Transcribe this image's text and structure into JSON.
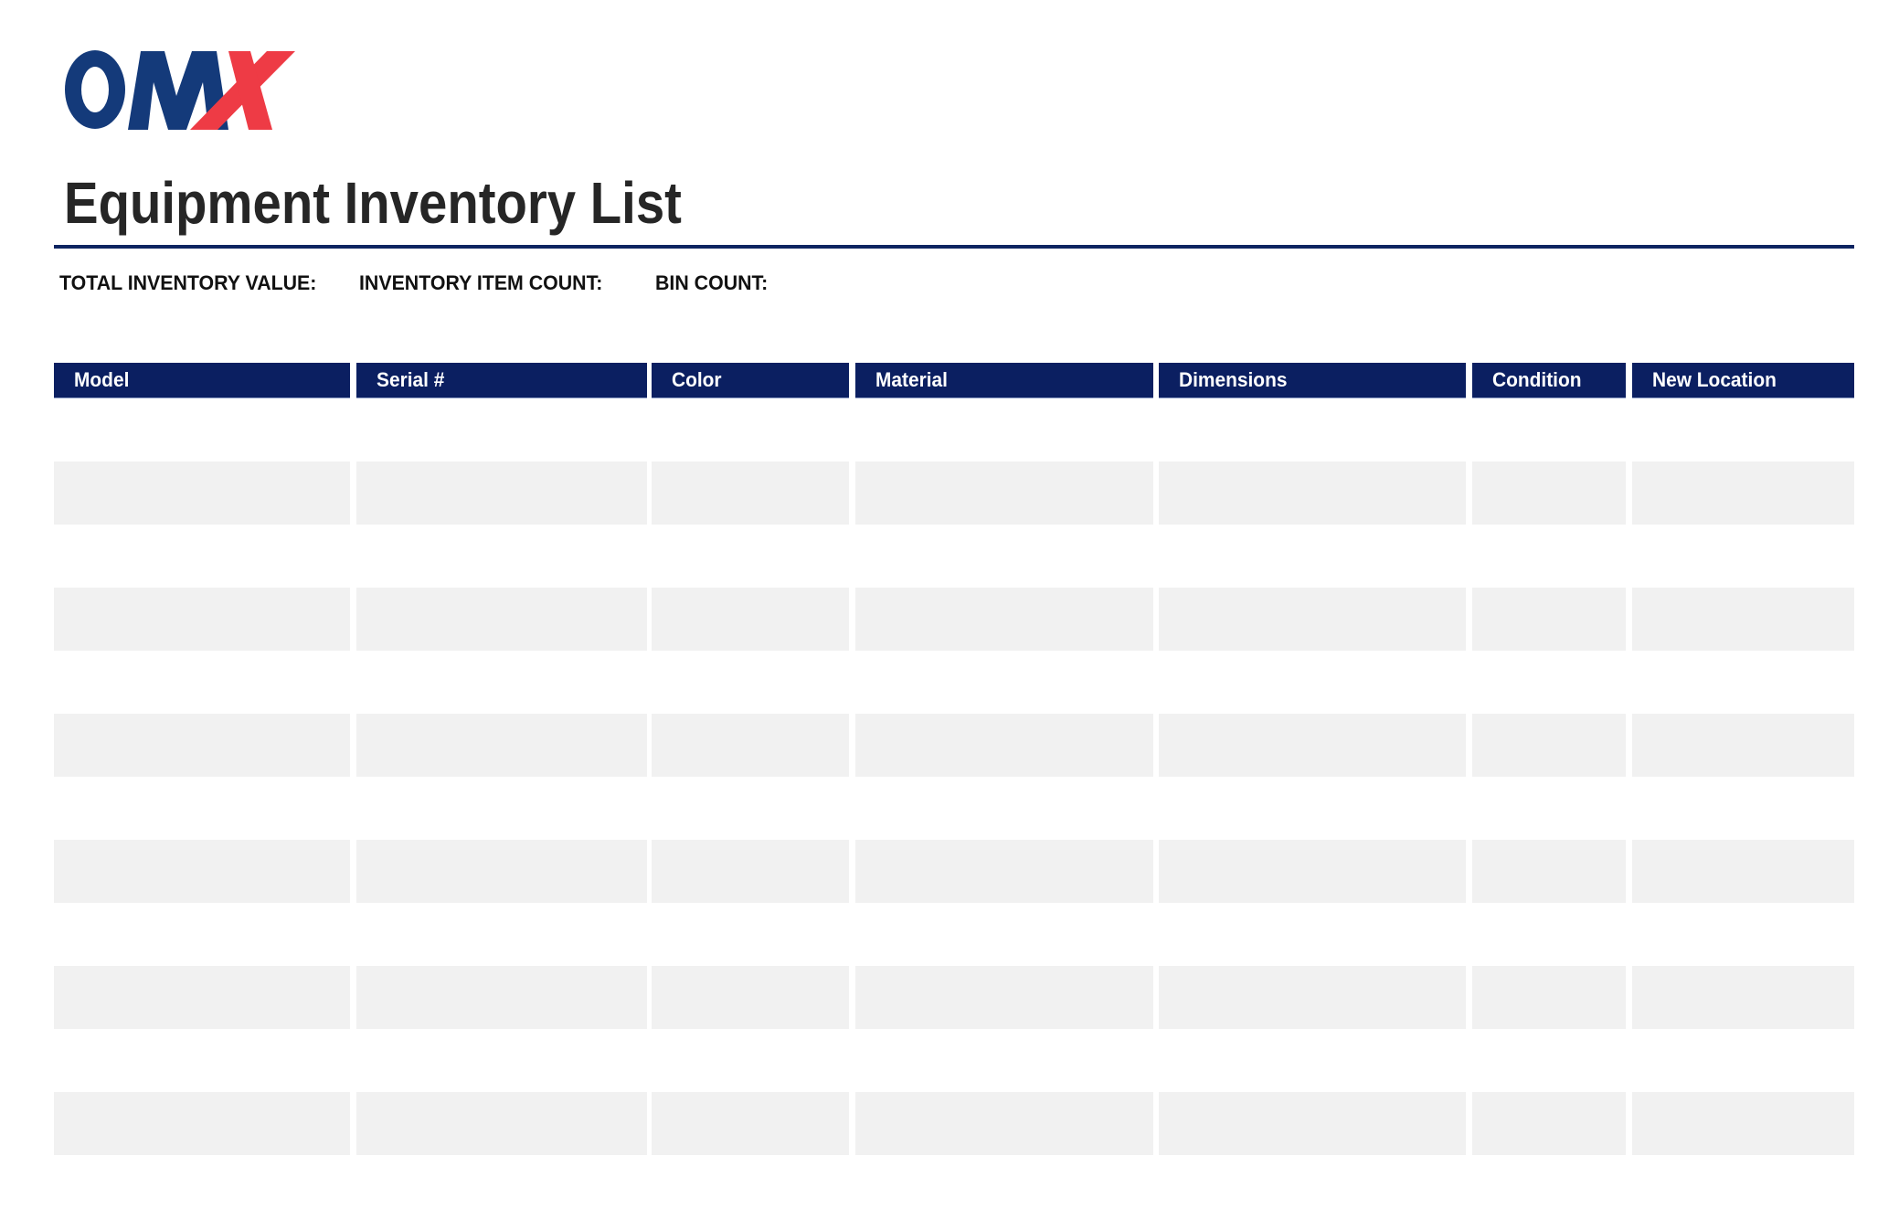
{
  "logo": {
    "text": "OMX",
    "colors": {
      "primary": "#143a7a",
      "accent": "#ee3b45"
    }
  },
  "document": {
    "title": "Equipment Inventory List"
  },
  "summary": {
    "total_value_label": "TOTAL INVENTORY VALUE:",
    "item_count_label": "INVENTORY ITEM COUNT:",
    "bin_count_label": "BIN COUNT:"
  },
  "table": {
    "columns": [
      {
        "label": "Model"
      },
      {
        "label": "Serial #"
      },
      {
        "label": "Color"
      },
      {
        "label": "Material"
      },
      {
        "label": "Dimensions"
      },
      {
        "label": "Condition"
      },
      {
        "label": "New Location"
      }
    ],
    "rows": [
      [
        "",
        "",
        "",
        "",
        "",
        "",
        ""
      ],
      [
        "",
        "",
        "",
        "",
        "",
        "",
        ""
      ],
      [
        "",
        "",
        "",
        "",
        "",
        "",
        ""
      ],
      [
        "",
        "",
        "",
        "",
        "",
        "",
        ""
      ],
      [
        "",
        "",
        "",
        "",
        "",
        "",
        ""
      ],
      [
        "",
        "",
        "",
        "",
        "",
        "",
        ""
      ],
      [
        "",
        "",
        "",
        "",
        "",
        "",
        ""
      ],
      [
        "",
        "",
        "",
        "",
        "",
        "",
        ""
      ],
      [
        "",
        "",
        "",
        "",
        "",
        "",
        ""
      ],
      [
        "",
        "",
        "",
        "",
        "",
        "",
        ""
      ],
      [
        "",
        "",
        "",
        "",
        "",
        "",
        ""
      ],
      [
        "",
        "",
        "",
        "",
        "",
        "",
        ""
      ]
    ],
    "colors": {
      "header_bg": "#0b1f61",
      "header_text": "#ffffff",
      "shaded_row": "#f1f1f1"
    }
  }
}
